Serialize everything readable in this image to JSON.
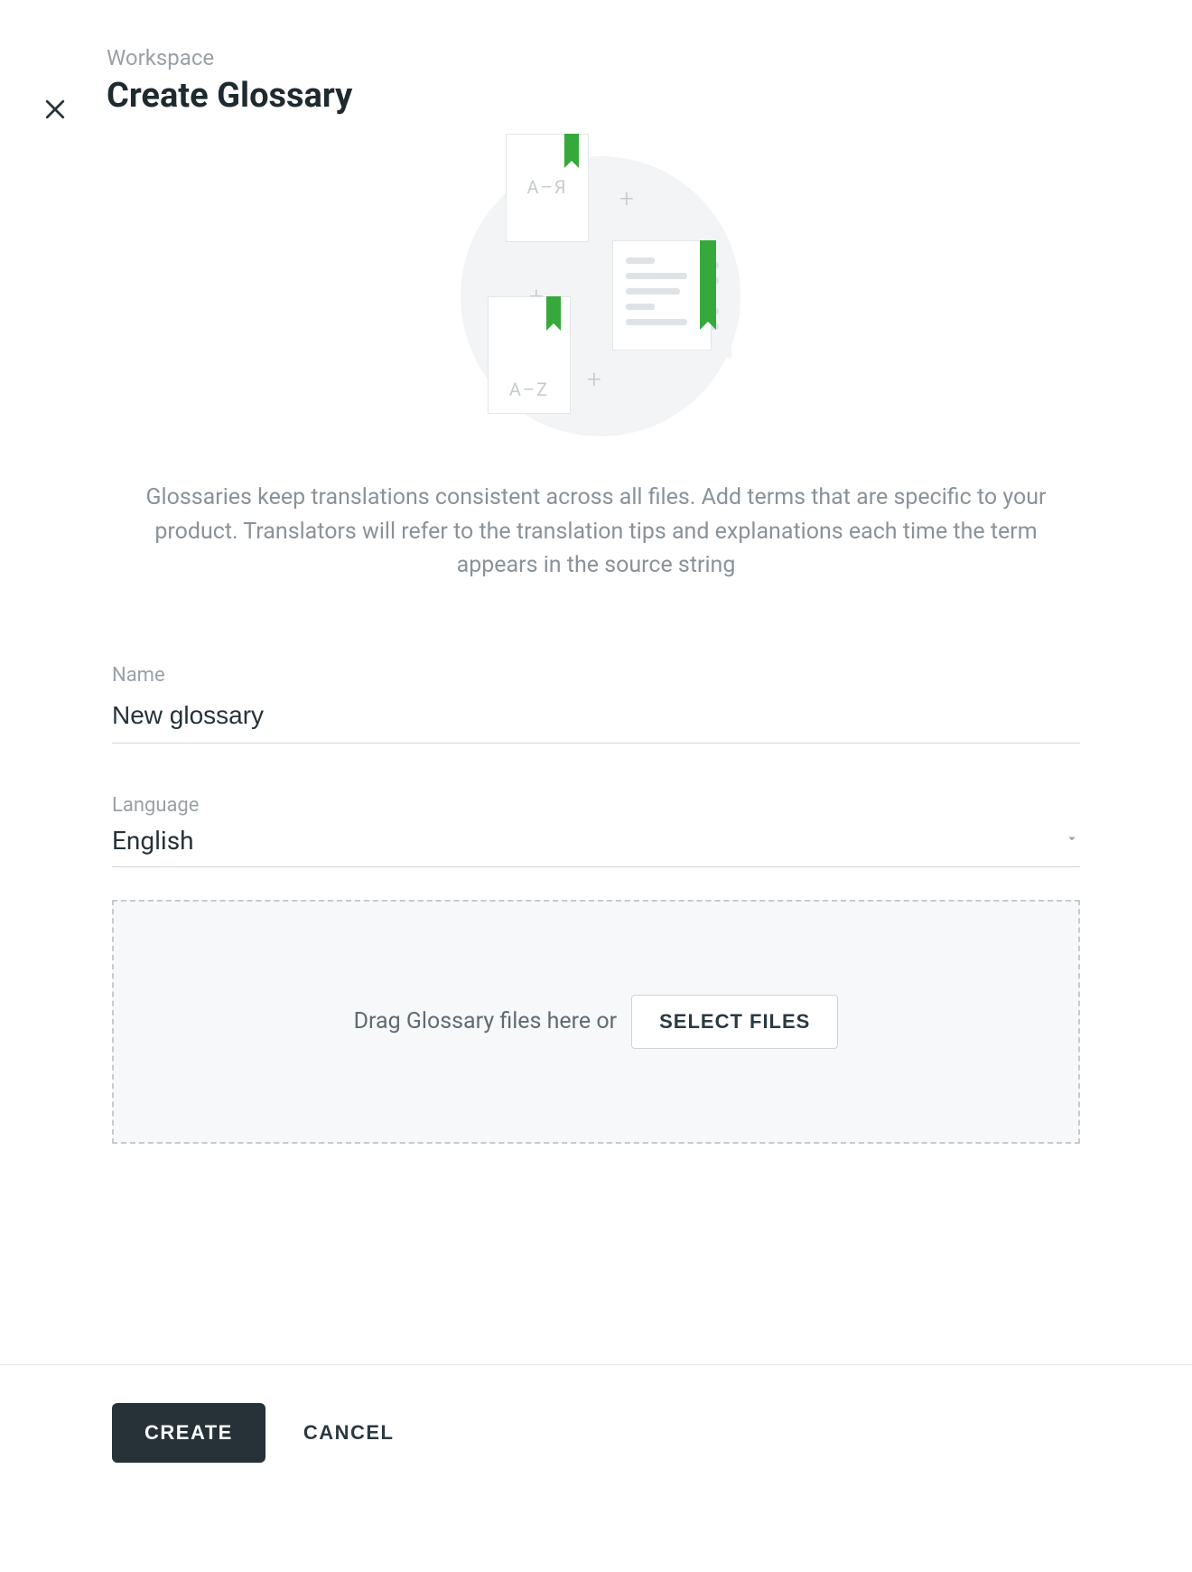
{
  "header": {
    "breadcrumb": "Workspace",
    "title": "Create Glossary"
  },
  "illustration": {
    "card1_label": "А–Я",
    "card3_label": "A–Z"
  },
  "description": "Glossaries keep translations consistent across all files. Add terms that are specific to your product. Translators will refer to the translation tips and explanations each time the term appears in the source string",
  "form": {
    "name_label": "Name",
    "name_value": "New glossary",
    "language_label": "Language",
    "language_value": "English"
  },
  "dropzone": {
    "text": "Drag Glossary files here or",
    "button": "SELECT FILES"
  },
  "footer": {
    "create": "CREATE",
    "cancel": "CANCEL"
  }
}
